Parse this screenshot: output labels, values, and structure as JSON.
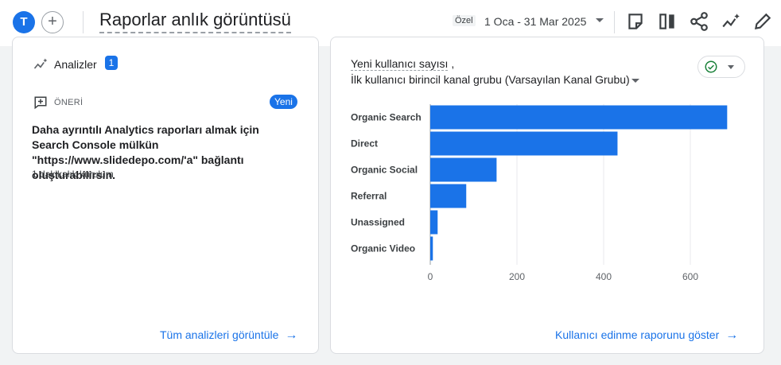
{
  "header": {
    "avatar_letter": "T",
    "add_label": "+",
    "title": "Raporlar anlık görüntüsü",
    "date_label": "Özel",
    "date_range": "1 Oca - 31 Mar 2025",
    "tools": [
      "customize-icon",
      "compare-icon",
      "share-icon",
      "insights-icon",
      "edit-icon"
    ]
  },
  "insights_card": {
    "title": "Analizler",
    "count": "1",
    "recommendation_label": "ÖNERİ",
    "new_badge": "Yeni",
    "recommendation_text": "Daha ayrıntılı Analytics raporları almak için Search Console mülkün \"https://www.slidedepo.com/'a\" bağlantı oluşturabilirsin.",
    "recommendation_sub": "1 dakikalık kurulum",
    "footer_link": "Tüm analizleri görüntüle"
  },
  "acquisition_card": {
    "metric_title": "Yeni kullanıcı sayısı",
    "metric_suffix": " ,",
    "dimension_title": "İlk kullanıcı birincil kanal grubu (Varsayılan Kanal Grubu)",
    "footer_link": "Kullanıcı edinme raporunu göster"
  },
  "colors": {
    "accent": "#1a73e8",
    "bar": "#1a73e8",
    "success": "#188038"
  },
  "chart_data": {
    "type": "bar",
    "orientation": "horizontal",
    "categories": [
      "Organic Search",
      "Direct",
      "Organic Social",
      "Referral",
      "Unassigned",
      "Organic Video"
    ],
    "values": [
      685,
      432,
      153,
      83,
      17,
      6
    ],
    "xticks": [
      "0",
      "200",
      "400",
      "600"
    ],
    "xlim": [
      0,
      700
    ],
    "grid": true
  }
}
